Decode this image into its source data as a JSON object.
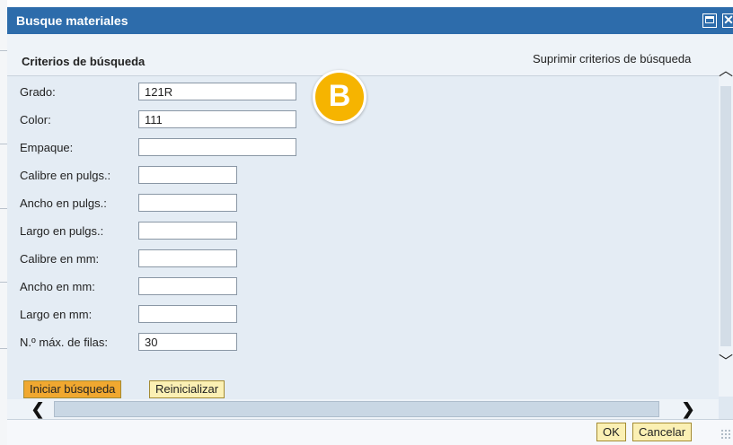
{
  "window": {
    "title": "Busque materiales"
  },
  "titlebar_icons": [
    "maximize-icon",
    "close-icon"
  ],
  "header": {
    "criteria_title": "Criterios de búsqueda",
    "suppress_link": "Suprimir criterios de búsqueda"
  },
  "fields": [
    {
      "label": "Grado:",
      "value": "121R"
    },
    {
      "label": "Color:",
      "value": "111"
    },
    {
      "label": "Empaque:",
      "value": ""
    },
    {
      "label": "Calibre en pulgs.:",
      "value": ""
    },
    {
      "label": "Ancho en pulgs.:",
      "value": ""
    },
    {
      "label": "Largo en pulgs.:",
      "value": ""
    },
    {
      "label": "Calibre en mm:",
      "value": ""
    },
    {
      "label": "Ancho en mm:",
      "value": ""
    },
    {
      "label": "Largo en mm:",
      "value": ""
    },
    {
      "label": "N.º máx. de filas:",
      "value": "30"
    }
  ],
  "badge": {
    "text": "B"
  },
  "actions": {
    "search": "Iniciar búsqueda",
    "reset": "Reinicializar"
  },
  "scroll": {
    "left": "❮",
    "right": "❯",
    "up": "︿",
    "down": "﹀"
  },
  "footer": {
    "ok": "OK",
    "cancel": "Cancelar"
  },
  "colors": {
    "titlebar": "#2d6cab",
    "badge": "#f6b400",
    "primary_button": "#f0a830",
    "secondary_button": "#fbf0b4"
  }
}
